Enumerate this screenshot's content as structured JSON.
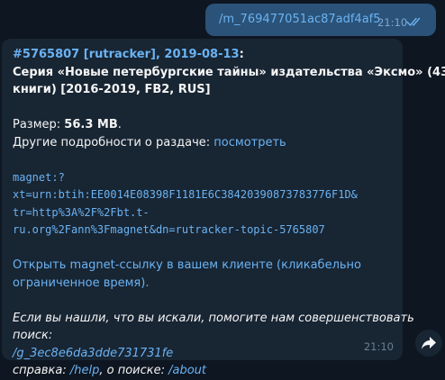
{
  "outgoing": {
    "text": "/m_769477051ac87adf4af5",
    "time": "21:10",
    "status_icon": "double-check-icon"
  },
  "incoming": {
    "header_id": "#5765807",
    "header_source": "[rutracker]",
    "header_date": "2019-08-13",
    "header_colon": ":",
    "title_line1": "Серия «Новые петербургские тайны» издательства «Эксмо» (43",
    "title_line2": "книги) [2016-2019, FB2, RUS]",
    "size_label": "Размер: ",
    "size_value": "56.3 MB",
    "size_dot": ".",
    "details_label": "Другие подробности о раздаче: ",
    "details_link": "посмотреть",
    "magnet_line1": "magnet:?",
    "magnet_line2": "xt=urn:btih:EE0014E08398F1181E6C38420390873783776F1D&",
    "magnet_line3": "tr=http%3A%2F%2Fbt.t-",
    "magnet_line4": "ru.org%2Fann%3Fmagnet&dn=rutracker-topic-5765807",
    "open_line1": "Открыть magnet-ссылку в вашем клиенте (кликабельно",
    "open_line2": "ограниченное время).",
    "feedback_line1": "Если вы нашли, что вы искали, помогите нам совершенствовать",
    "feedback_line2": "поиск:",
    "feedback_link": "/g_3ec8e6da3dde731731fe",
    "help_label": "справка: ",
    "help_link": "/help",
    "about_label": ", о поиске: ",
    "about_link": "/about",
    "time": "21:10"
  },
  "share_icon": "share-arrow-icon",
  "colors": {
    "background": "#0e1621",
    "outgoing_bubble": "#2b5278",
    "incoming_bubble": "#182533",
    "link": "#6ab3f3"
  }
}
